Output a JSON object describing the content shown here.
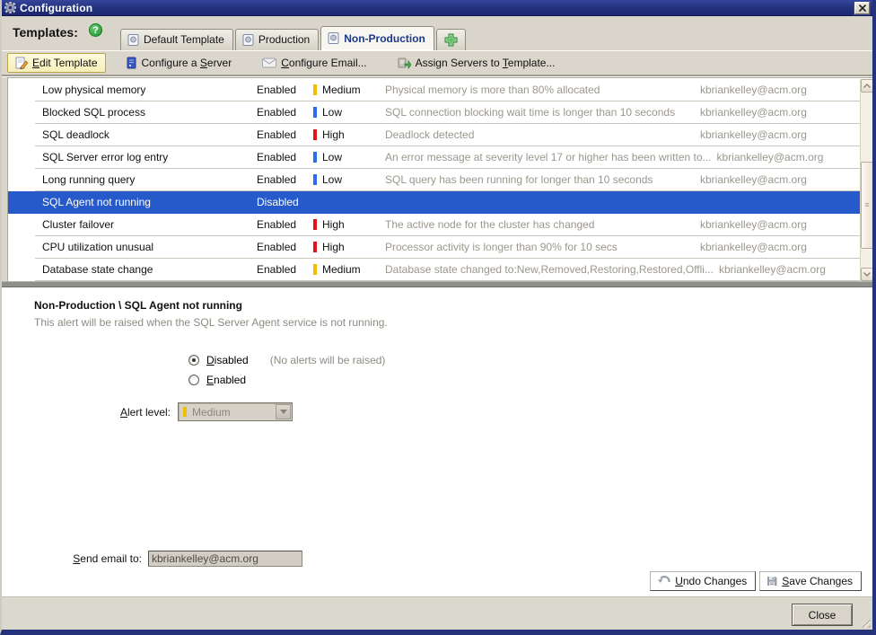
{
  "window": {
    "title": "Configuration"
  },
  "templates_label": "Templates:",
  "tabs": {
    "items": [
      {
        "label": "Default Template",
        "active": false
      },
      {
        "label": "Production",
        "active": false
      },
      {
        "label": "Non-Production",
        "active": true
      }
    ]
  },
  "toolbar": {
    "edit": {
      "u": "E",
      "post": "dit Template"
    },
    "configure_server": {
      "pre": "Configure a ",
      "u": "S",
      "post": "erver"
    },
    "configure_email": {
      "u": "C",
      "post": "onfigure Email..."
    },
    "assign": {
      "pre": "Assign Servers to ",
      "u": "T",
      "post": "emplate..."
    }
  },
  "level_colors": {
    "Medium": "#f0c000",
    "Low": "#2a6df0",
    "High": "#e41414"
  },
  "selection_color": "#2659c9",
  "table": {
    "rows": [
      {
        "name": "Low physical memory",
        "status": "Enabled",
        "level": "Medium",
        "desc": "Physical memory is more than 80% allocated",
        "email": "kbriankelley@acm.org",
        "selected": false
      },
      {
        "name": "Blocked SQL process",
        "status": "Enabled",
        "level": "Low",
        "desc": "SQL connection blocking wait time is longer than 10 seconds",
        "email": "kbriankelley@acm.org",
        "selected": false
      },
      {
        "name": "SQL deadlock",
        "status": "Enabled",
        "level": "High",
        "desc": "Deadlock detected",
        "email": "kbriankelley@acm.org",
        "selected": false
      },
      {
        "name": "SQL Server error log entry",
        "status": "Enabled",
        "level": "Low",
        "desc": "An error message at severity level 17 or higher has been written to...",
        "email": "kbriankelley@acm.org",
        "selected": false
      },
      {
        "name": "Long running query",
        "status": "Enabled",
        "level": "Low",
        "desc": "SQL query has been running for longer than 10 seconds",
        "email": "kbriankelley@acm.org",
        "selected": false
      },
      {
        "name": "SQL Agent not running",
        "status": "Disabled",
        "level": "",
        "desc": "",
        "email": "",
        "selected": true
      },
      {
        "name": "Cluster failover",
        "status": "Enabled",
        "level": "High",
        "desc": "The active node for the cluster has changed",
        "email": "kbriankelley@acm.org",
        "selected": false
      },
      {
        "name": "CPU utilization unusual",
        "status": "Enabled",
        "level": "High",
        "desc": "Processor activity is longer than 90% for 10 secs",
        "email": "kbriankelley@acm.org",
        "selected": false
      },
      {
        "name": "Database state change",
        "status": "Enabled",
        "level": "Medium",
        "desc": "Database state changed to:New,Removed,Restoring,Restored,Offli...",
        "email": "kbriankelley@acm.org",
        "selected": false
      }
    ]
  },
  "detail": {
    "title": "Non-Production \\ SQL Agent not running",
    "description": "This alert will be raised when the SQL Server Agent service is not running.",
    "selected_option": "Disabled",
    "radio_disabled": {
      "u": "D",
      "post": "isabled"
    },
    "radio_disabled_note": "(No alerts will be raised)",
    "radio_enabled": {
      "u": "E",
      "post": "nabled"
    },
    "alert_level_label": {
      "u": "A",
      "post": "lert level:"
    },
    "alert_level_value": "Medium",
    "send_email_label": {
      "u": "S",
      "post": "end email to:"
    },
    "send_email_value": "kbriankelley@acm.org",
    "undo_button": {
      "u": "U",
      "post": "ndo Changes"
    },
    "save_button": {
      "u": "S",
      "post": "ave Changes"
    }
  },
  "footer": {
    "close_label": "Close"
  },
  "icons": {
    "titlebar": "gear-icon",
    "help": "help-icon",
    "tab": "template-page-icon",
    "add_tab": "add-plus-icon",
    "edit": "edit-page-icon",
    "configure_server": "server-icon",
    "configure_email": "envelope-icon",
    "assign": "assign-server-icon",
    "undo": "undo-arrow-icon",
    "save": "floppy-disk-icon",
    "close_window": "close-x-icon",
    "scrollbar": "scroll-arrows",
    "resize": "resize-grip"
  }
}
